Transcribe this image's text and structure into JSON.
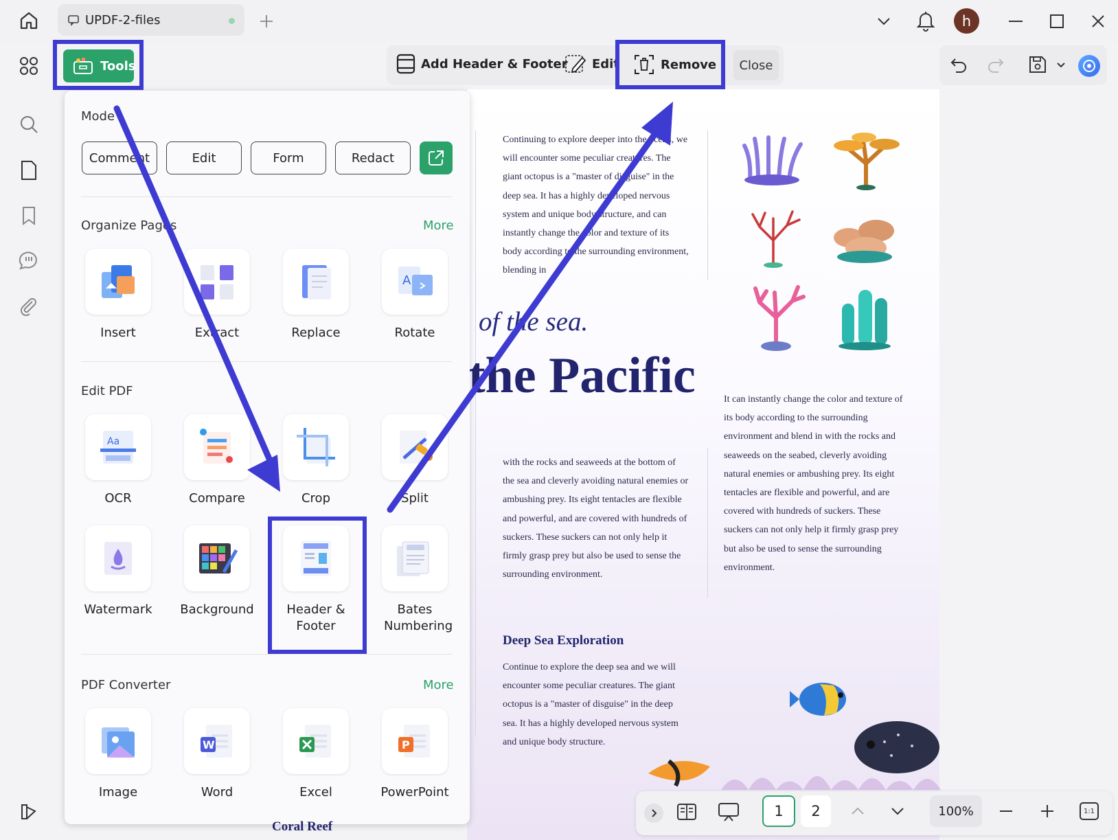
{
  "tab": {
    "title": "UPDF-2-files"
  },
  "user": {
    "avatar_letter": "h"
  },
  "toolbar": {
    "tools_label": "Tools",
    "add_header_footer_label": "Add Header & Footer",
    "edit_label": "Edit",
    "remove_label": "Remove",
    "close_label": "Close"
  },
  "panel": {
    "mode_title": "Mode",
    "mode_buttons": [
      "Comment",
      "Edit",
      "Form",
      "Redact"
    ],
    "organize_title": "Organize Pages",
    "organize_more": "More",
    "organize_items": [
      "Insert",
      "Extract",
      "Replace",
      "Rotate"
    ],
    "edit_title": "Edit PDF",
    "edit_items": [
      "OCR",
      "Compare",
      "Crop",
      "Split",
      "Watermark",
      "Background",
      "Header & Footer",
      "Bates Numbering"
    ],
    "converter_title": "PDF Converter",
    "converter_more": "More",
    "converter_items": [
      "Image",
      "Word",
      "Excel",
      "PowerPoint"
    ]
  },
  "document": {
    "col1_top": "Continuing to explore deeper into the ocean, we will encounter some peculiar creatures. The giant octopus is a \"master of disguise\" in the deep sea. It has a highly developed nervous system and unique body structure, and can instantly change the color and texture of its body according to the surrounding environment, blending in",
    "sea_text": "of the sea.",
    "pacific_text": "the Pacific",
    "col2_text": "It can instantly change the color and texture of its body according to the surrounding environment and blend in with the rocks and seaweeds on the seabed, cleverly avoiding natural enemies or ambushing prey. Its eight tentacles are flexible and powerful, and are covered with hundreds of suckers. These suckers can not only help it firmly grasp prey but also be used to sense the surrounding environment.",
    "col1_mid": "with the rocks and seaweeds at the bottom of the sea and cleverly avoiding natural enemies or ambushing prey. Its eight tentacles are flexible and powerful, and are covered with hundreds of suckers. These suckers can not only help it firmly grasp prey but also be used to sense the surrounding environment.",
    "deep_sea_heading": "Deep Sea Exploration",
    "col1_bottom": "Continue to explore the deep sea and we will encounter some peculiar creatures. The giant octopus is a \"master of disguise\" in the deep sea. It has a highly developed nervous system and unique body structure.",
    "footer_text": "Coral Reef"
  },
  "bottombar": {
    "page1": "1",
    "page2": "2",
    "zoom": "100%",
    "fit_label": "1:1"
  },
  "colors": {
    "accent": "#2aa26a",
    "highlight": "#3d3bd1",
    "heading": "#22246e"
  }
}
